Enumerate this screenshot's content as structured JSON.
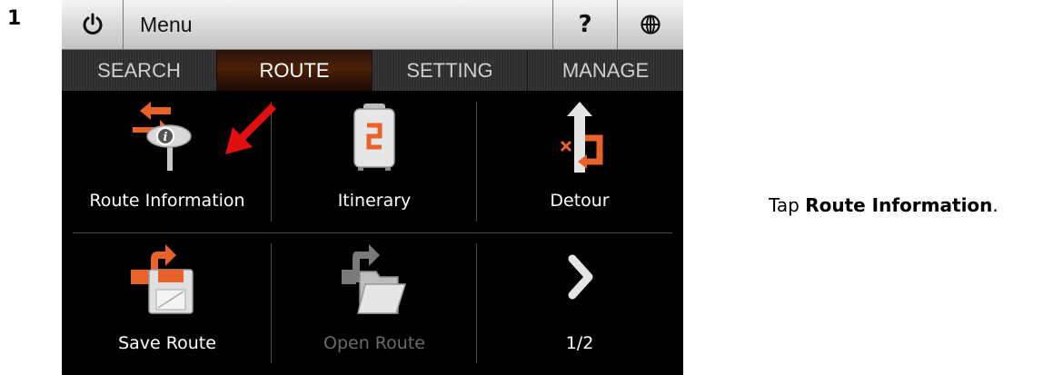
{
  "step_number": "1",
  "topbar": {
    "power_icon": "power-icon",
    "menu_label": "Menu",
    "help_label": "?",
    "globe_icon": "globe-icon"
  },
  "tabs": [
    {
      "label": "SEARCH",
      "active": false
    },
    {
      "label": "ROUTE",
      "active": true
    },
    {
      "label": "SETTING",
      "active": false
    },
    {
      "label": "MANAGE",
      "active": false
    }
  ],
  "grid": {
    "items": [
      {
        "label": "Route Information",
        "icon": "route-information-icon",
        "enabled": true
      },
      {
        "label": "Itinerary",
        "icon": "itinerary-icon",
        "enabled": true
      },
      {
        "label": "Detour",
        "icon": "detour-icon",
        "enabled": true
      },
      {
        "label": "Save Route",
        "icon": "save-route-icon",
        "enabled": true
      },
      {
        "label": "Open Route",
        "icon": "open-route-icon",
        "enabled": false
      },
      {
        "label": "1/2",
        "icon": "next-page-icon",
        "enabled": true
      }
    ]
  },
  "instruction": {
    "prefix": "Tap ",
    "bold": "Route Information",
    "suffix": "."
  },
  "colors": {
    "accent_orange": "#e8622a",
    "pointer_red": "#e01010",
    "active_tab": "#4a2008"
  }
}
